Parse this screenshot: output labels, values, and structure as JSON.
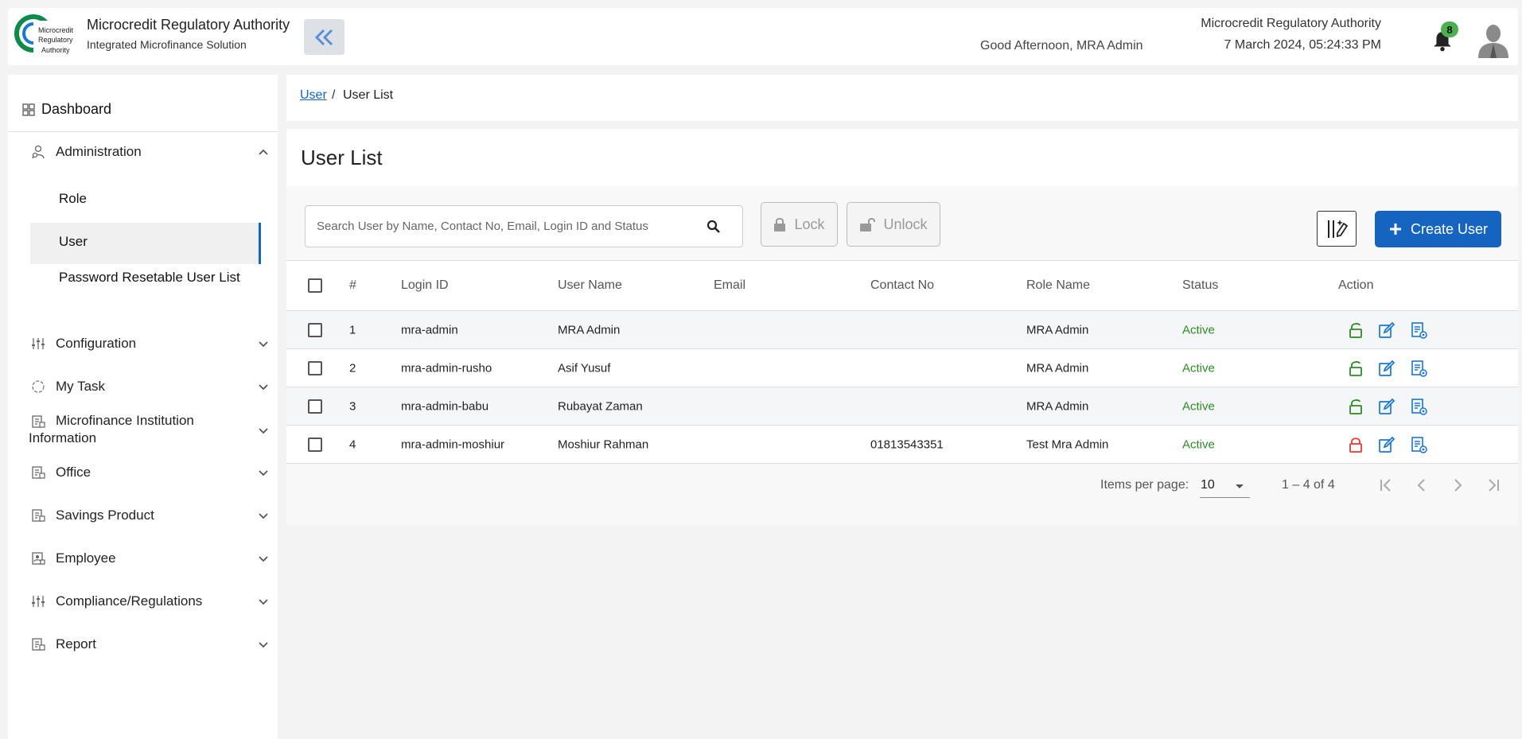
{
  "header": {
    "app_title": "Microcredit Regulatory Authority",
    "app_subtitle": "Integrated Microfinance Solution",
    "logo_text": [
      "Microcredit",
      "Regulatory",
      "Authority"
    ],
    "greeting": "Good Afternoon, MRA Admin",
    "org_name": "Microcredit Regulatory Authority",
    "datetime": "7 March 2024, 05:24:33 PM",
    "notification_count": "8",
    "icons": {
      "collapse": "double-chevron-left-icon",
      "bell": "bell-icon",
      "avatar": "user-avatar-icon"
    }
  },
  "sidebar": {
    "dashboard": "Dashboard",
    "administration": "Administration",
    "admin_sub": [
      "Role",
      "User",
      "Password Resetable User List"
    ],
    "items": [
      {
        "label": "Configuration",
        "icon": "sliders-icon"
      },
      {
        "label": "My Task",
        "icon": "task-cycle-icon"
      },
      {
        "label": "Microfinance Institution Information",
        "icon": "building-doc-icon"
      },
      {
        "label": "Office",
        "icon": "building-doc-icon"
      },
      {
        "label": "Savings Product",
        "icon": "building-doc-icon"
      },
      {
        "label": "Employee",
        "icon": "employee-icon"
      },
      {
        "label": "Compliance/Regulations",
        "icon": "sliders-icon"
      },
      {
        "label": "Report",
        "icon": "building-doc-icon"
      }
    ],
    "active_color": "#1565c0"
  },
  "breadcrumb": {
    "parent": "User",
    "separator": "/",
    "current": "User List"
  },
  "main": {
    "title": "User List",
    "search_placeholder": "Search User by Name, Contact No, Email, Login ID and Status",
    "lock_label": "Lock",
    "unlock_label": "Unlock",
    "create_label": "Create User",
    "primary_color": "#1565c0"
  },
  "table": {
    "headers": [
      "#",
      "Login ID",
      "User Name",
      "Email",
      "Contact No",
      "Role Name",
      "Status",
      "Action"
    ],
    "rows": [
      {
        "num": "1",
        "login": "mra-admin",
        "name": "MRA Admin",
        "email": "",
        "contact": "",
        "role": "MRA Admin",
        "status": "Active",
        "locked": false
      },
      {
        "num": "2",
        "login": "mra-admin-rusho",
        "name": "Asif Yusuf",
        "email": "",
        "contact": "",
        "role": "MRA Admin",
        "status": "Active",
        "locked": false
      },
      {
        "num": "3",
        "login": "mra-admin-babu",
        "name": "Rubayat Zaman",
        "email": "",
        "contact": "",
        "role": "MRA Admin",
        "status": "Active",
        "locked": false
      },
      {
        "num": "4",
        "login": "mra-admin-moshiur",
        "name": "Moshiur Rahman",
        "email": "",
        "contact": "01813543351",
        "role": "Test Mra Admin",
        "status": "Active",
        "locked": true
      }
    ],
    "status_color": "#2e8b24",
    "unlock_color": "#2e8b24",
    "lock_color": "#e53935"
  },
  "pager": {
    "items_per_page_label": "Items per page:",
    "items_per_page": "10",
    "range": "1 – 4 of 4"
  }
}
